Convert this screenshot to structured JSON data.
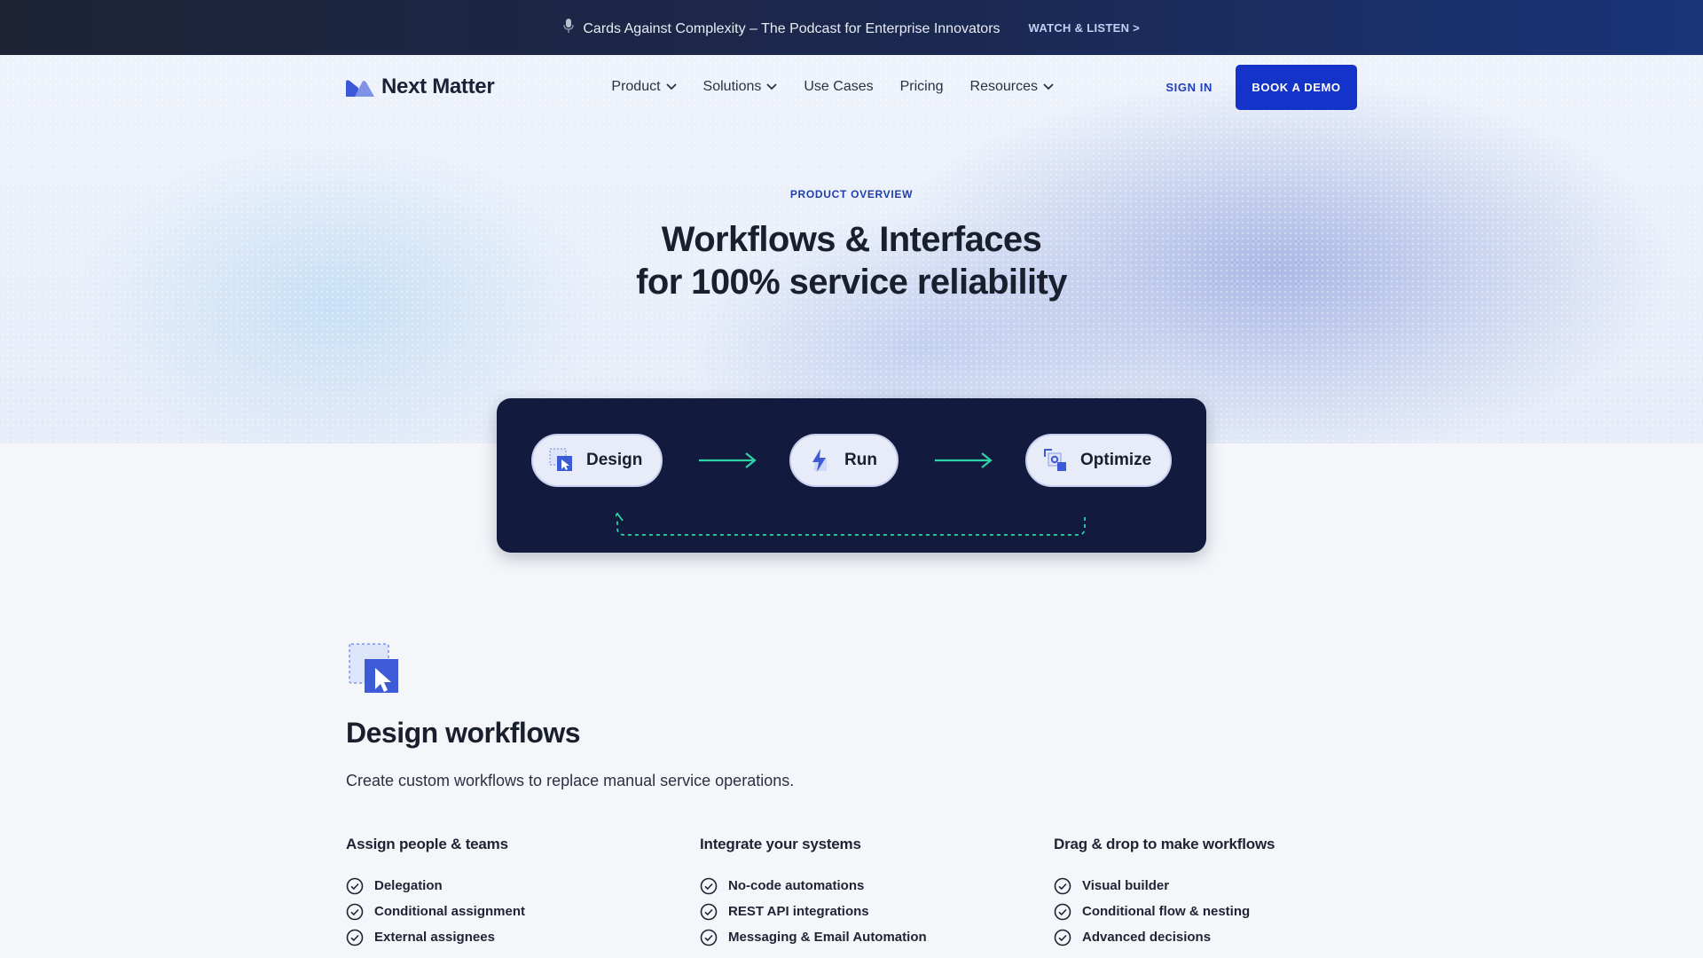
{
  "announcement": {
    "text": "Cards Against Complexity – The Podcast for Enterprise Innovators",
    "cta": "WATCH & LISTEN >",
    "icon": "microphone-icon"
  },
  "nav": {
    "logo": "Next Matter",
    "items": [
      {
        "label": "Product",
        "dropdown": true
      },
      {
        "label": "Solutions",
        "dropdown": true
      },
      {
        "label": "Use Cases",
        "dropdown": false
      },
      {
        "label": "Pricing",
        "dropdown": false
      },
      {
        "label": "Resources",
        "dropdown": true
      }
    ],
    "signin": "SIGN IN",
    "demo": "BOOK A DEMO"
  },
  "hero": {
    "eyebrow": "PRODUCT OVERVIEW",
    "title_line1": "Workflows & Interfaces",
    "title_line2": "for 100% service reliability"
  },
  "flow": {
    "steps": [
      {
        "label": "Design",
        "icon": "design-cursor-icon"
      },
      {
        "label": "Run",
        "icon": "lightning-icon"
      },
      {
        "label": "Optimize",
        "icon": "optimize-gear-icon"
      }
    ]
  },
  "design_section": {
    "title": "Design workflows",
    "subtitle": "Create custom workflows to replace manual service operations.",
    "columns": [
      {
        "heading": "Assign people & teams",
        "items": [
          "Delegation",
          "Conditional assignment",
          "External assignees"
        ]
      },
      {
        "heading": "Integrate your systems",
        "items": [
          "No-code automations",
          "REST API integrations",
          "Messaging & Email Automation"
        ]
      },
      {
        "heading": "Drag & drop to make workflows",
        "items": [
          "Visual builder",
          "Conditional flow & nesting",
          "Advanced decisions"
        ]
      }
    ]
  },
  "colors": {
    "accent": "#1434c9",
    "panel": "#121b3d",
    "flow_arrow": "#2fd3a8"
  }
}
